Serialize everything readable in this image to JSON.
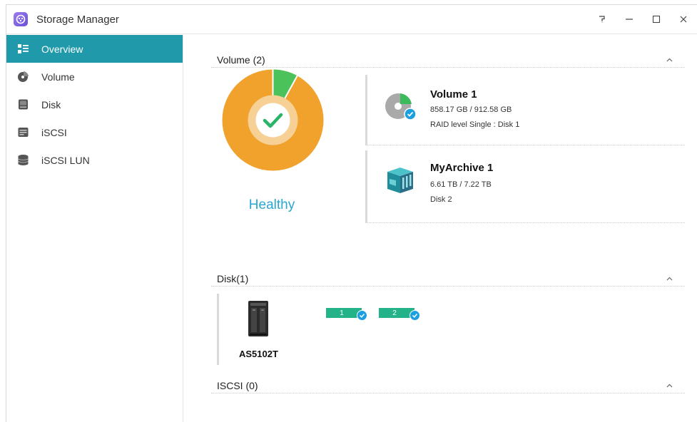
{
  "window": {
    "title": "Storage Manager",
    "controls": {
      "help": "?",
      "minimize": "—",
      "maximize": "☐",
      "close": "✕"
    }
  },
  "sidebar": {
    "items": [
      {
        "label": "Overview",
        "icon": "overview-icon",
        "active": true
      },
      {
        "label": "Volume",
        "icon": "volume-icon",
        "active": false
      },
      {
        "label": "Disk",
        "icon": "disk-icon",
        "active": false
      },
      {
        "label": "iSCSI",
        "icon": "iscsi-icon",
        "active": false
      },
      {
        "label": "iSCSI LUN",
        "icon": "iscsi-lun-icon",
        "active": false
      }
    ]
  },
  "volume_section": {
    "title": "Volume (2)",
    "health_status": "Healthy",
    "donut": {
      "used_fraction": 0.92,
      "used_color": "#f0a22d",
      "free_color": "#4cc35a"
    },
    "volumes": [
      {
        "name": "Volume 1",
        "size": "858.17 GB / 912.58 GB",
        "desc": "RAID level Single : Disk 1",
        "icon": "volume-pie-icon"
      },
      {
        "name": "MyArchive 1",
        "size": "6.61 TB / 7.22 TB",
        "desc": "Disk 2",
        "icon": "archive-icon"
      }
    ]
  },
  "disk_section": {
    "title": "Disk(1)",
    "device_name": "AS5102T",
    "slots": [
      "1",
      "2"
    ]
  },
  "iscsi_section": {
    "title": "ISCSI (0)"
  },
  "colors": {
    "accent": "#2099aa",
    "healthy": "#2aa6cf",
    "disk_ok": "#24b389",
    "check": "#1a9fe0"
  }
}
